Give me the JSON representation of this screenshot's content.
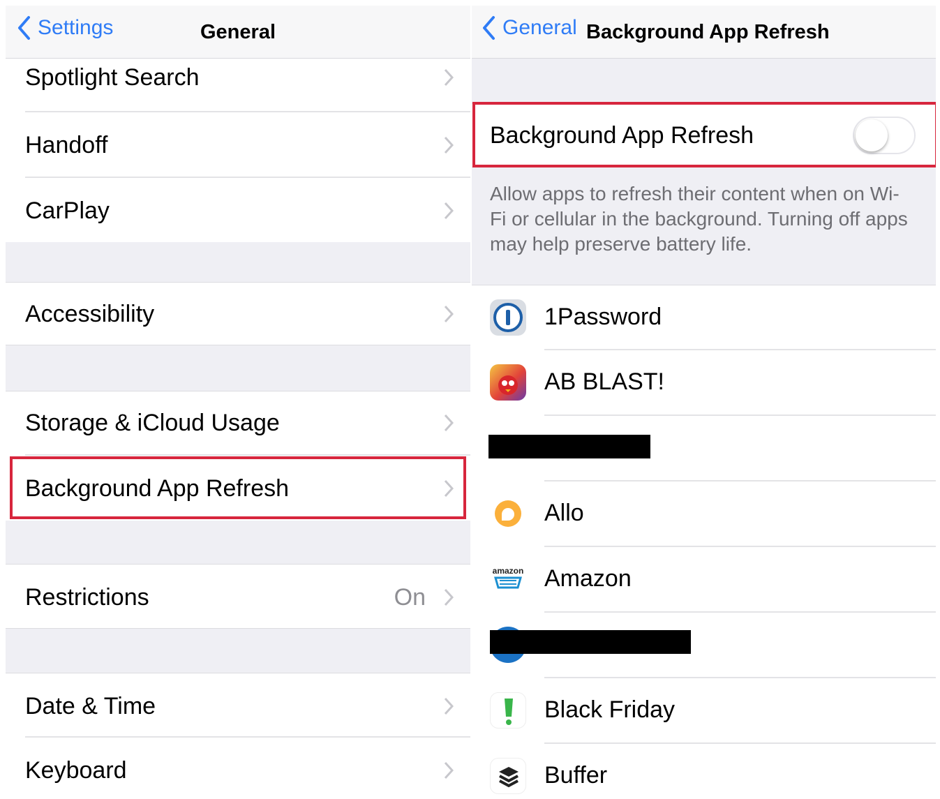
{
  "left": {
    "nav": {
      "back_label": "Settings",
      "title": "General"
    },
    "rows": {
      "spotlight": "Spotlight Search",
      "handoff": "Handoff",
      "carplay": "CarPlay",
      "accessibility": "Accessibility",
      "storage": "Storage & iCloud Usage",
      "background_refresh": "Background App Refresh",
      "restrictions": "Restrictions",
      "restrictions_value": "On",
      "date_time": "Date & Time",
      "keyboard": "Keyboard"
    }
  },
  "right": {
    "nav": {
      "back_label": "General",
      "title": "Background App Refresh"
    },
    "master_toggle": {
      "label": "Background App Refresh",
      "on": false
    },
    "footnote": "Allow apps to refresh their content when on Wi-Fi or cellular in the background. Turning off apps may help preserve battery life.",
    "apps": {
      "onepassword": "1Password",
      "abblast": "AB BLAST!",
      "allo": "Allo",
      "amazon": "Amazon",
      "blackfriday": "Black Friday",
      "buffer": "Buffer"
    },
    "amazon_logo_text": "amazon"
  },
  "colors": {
    "ios_blue": "#2f7cf6",
    "highlight_red": "#d7263d",
    "group_bg": "#efeff4"
  }
}
